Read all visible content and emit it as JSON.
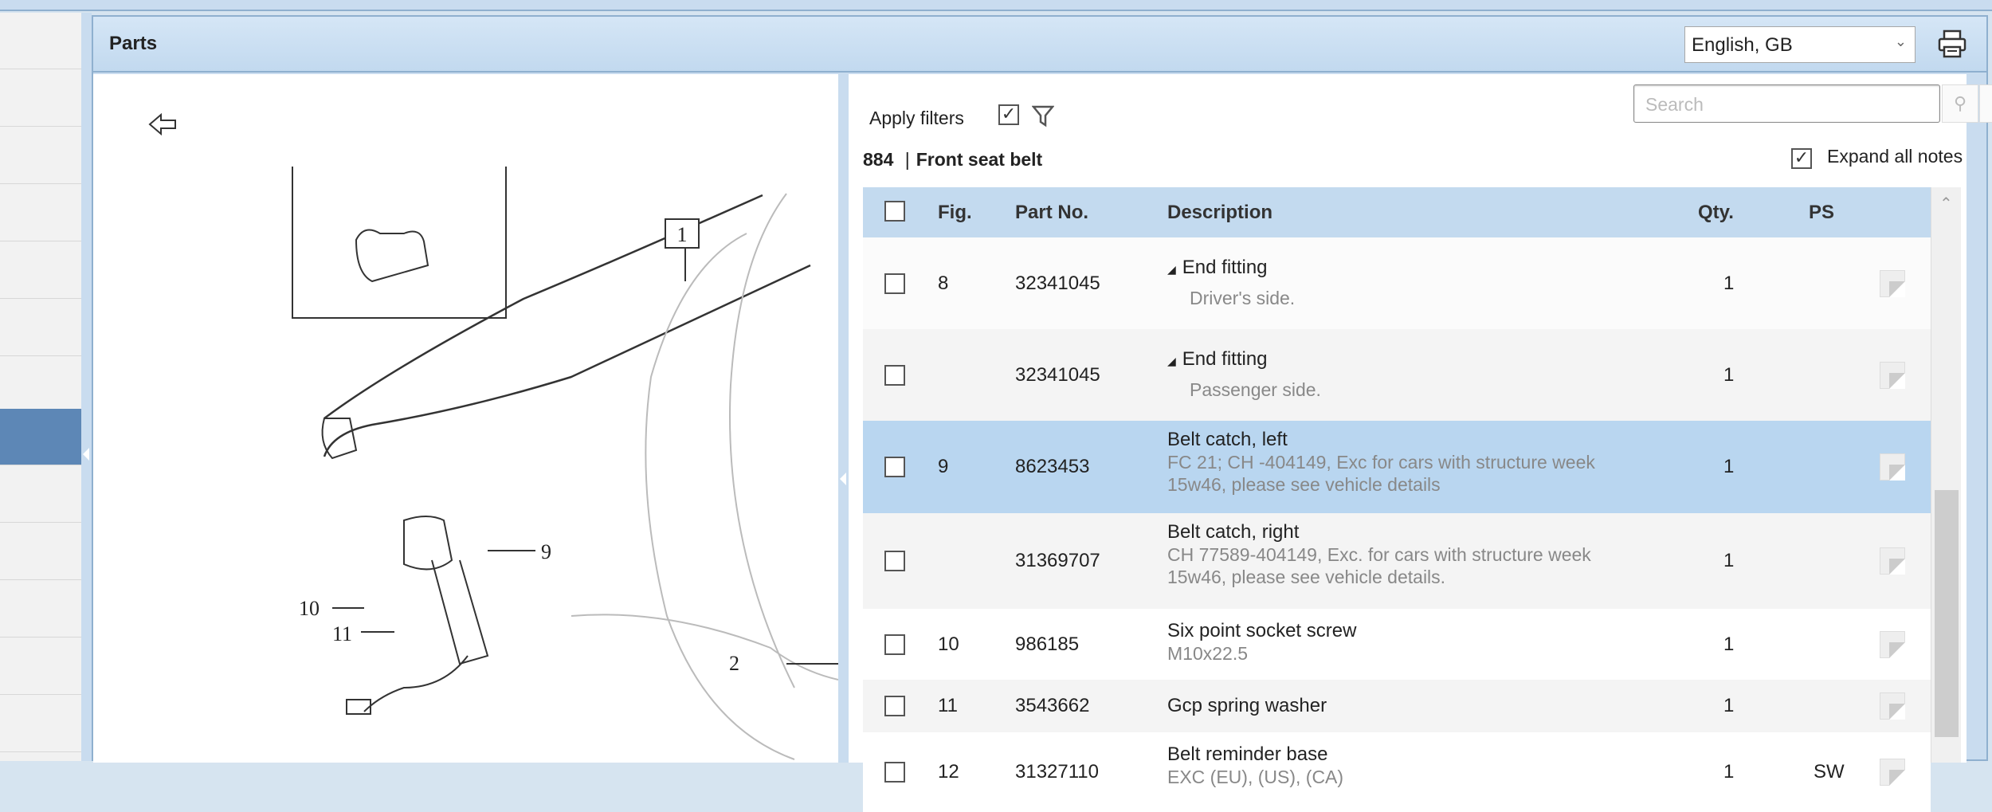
{
  "panel": {
    "title": "Parts",
    "language": "English, GB"
  },
  "toolbar": {
    "apply_filters": "Apply filters",
    "search_placeholder": "Search",
    "expand_all_notes": "Expand all notes"
  },
  "group": {
    "number": "884",
    "separator": "|",
    "name": "Front seat belt"
  },
  "table": {
    "headers": {
      "fig": "Fig.",
      "part": "Part No.",
      "desc": "Description",
      "qty": "Qty.",
      "ps": "PS"
    },
    "rows": [
      {
        "fig": "8",
        "part": "32341045",
        "desc": "End fitting",
        "note": "Driver's side.",
        "qty": "1",
        "ps": "",
        "expandable": true
      },
      {
        "fig": "",
        "part": "32341045",
        "desc": "End fitting",
        "note": "Passenger side.",
        "qty": "1",
        "ps": "",
        "expandable": true
      },
      {
        "fig": "9",
        "part": "8623453",
        "desc": "Belt catch, left",
        "note": "FC 21; CH -404149, Exc for cars with structure week 15w46, please see vehicle details",
        "qty": "1",
        "ps": "",
        "selected": true
      },
      {
        "fig": "",
        "part": "31369707",
        "desc": "Belt catch, right",
        "note": "CH 77589-404149, Exc. for cars with structure week 15w46, please see vehicle details.",
        "qty": "1",
        "ps": ""
      },
      {
        "fig": "10",
        "part": "986185",
        "desc": "Six point socket screw",
        "note": "M10x22.5",
        "qty": "1",
        "ps": ""
      },
      {
        "fig": "11",
        "part": "3543662",
        "desc": "Gcp spring washer",
        "note": "",
        "qty": "1",
        "ps": ""
      },
      {
        "fig": "12",
        "part": "31327110",
        "desc": "Belt reminder base",
        "note": "EXC (EU), (US), (CA)",
        "qty": "1",
        "ps": "SW"
      }
    ]
  },
  "diagram": {
    "callouts": {
      "c1": "1",
      "c2": "2",
      "c9": "9",
      "c10": "10",
      "c11": "11"
    }
  },
  "colors": {
    "header": "#c3daef",
    "selected_row": "#b9d6f0",
    "sidebar_selected": "#5d87b6"
  }
}
